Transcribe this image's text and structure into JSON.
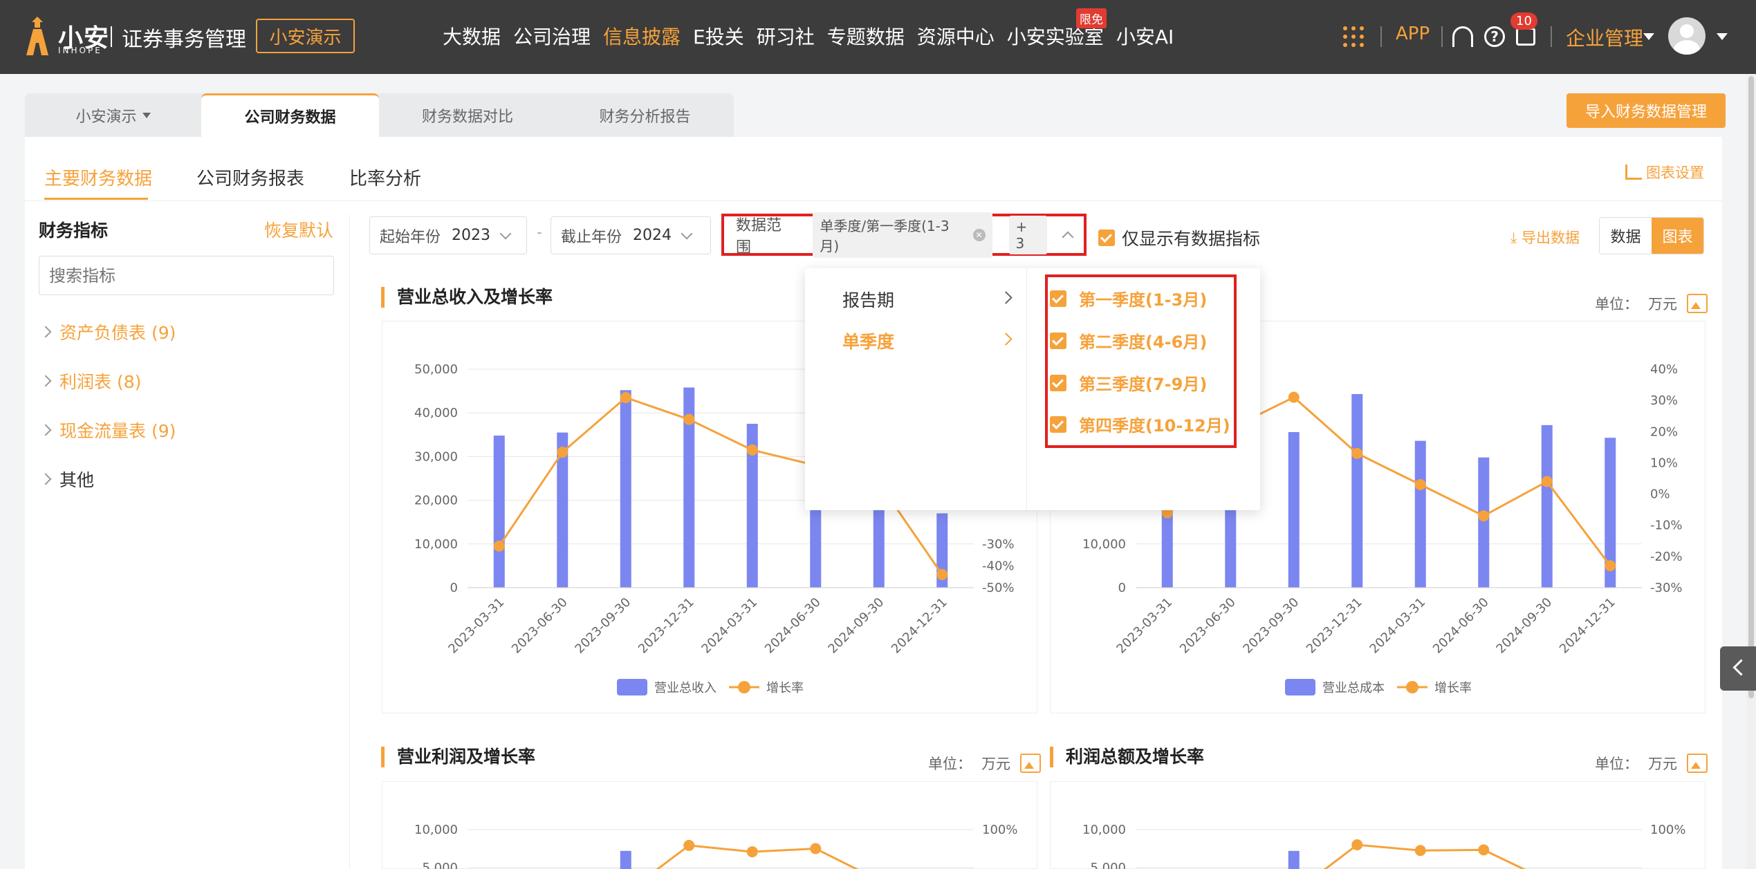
{
  "header": {
    "logo_text": "小安",
    "logo_sub": "INHOPE",
    "system_title": "证券事务管理",
    "demo_button": "小安演示",
    "nav": [
      {
        "label": "大数据",
        "active": false
      },
      {
        "label": "公司治理",
        "active": false
      },
      {
        "label": "信息披露",
        "active": true
      },
      {
        "label": "E投关",
        "active": false
      },
      {
        "label": "研习社",
        "active": false
      },
      {
        "label": "专题数据",
        "active": false
      },
      {
        "label": "资源中心",
        "active": false
      },
      {
        "label": "小安实验室",
        "active": false
      },
      {
        "label": "小安AI",
        "active": false
      }
    ],
    "free_badge": "限免",
    "app_link": "APP",
    "message_count": "10",
    "enterprise": "企业管理",
    "icons": [
      "apps-grid-icon",
      "headset-icon",
      "help-icon",
      "message-icon",
      "avatar"
    ]
  },
  "tabs": [
    {
      "label": "小安演示",
      "dropdown": true
    },
    {
      "label": "公司财务数据",
      "active": true
    },
    {
      "label": "财务数据对比"
    },
    {
      "label": "财务分析报告"
    }
  ],
  "import_button": "导入财务数据管理",
  "subtabs": [
    "主要财务数据",
    "公司财务报表",
    "比率分析"
  ],
  "chart_settings": "图表设置",
  "sidebar": {
    "title": "财务指标",
    "restore": "恢复默认",
    "search_placeholder": "搜索指标",
    "items": [
      {
        "label": "资产负债表 (9)"
      },
      {
        "label": "利润表 (8)"
      },
      {
        "label": "现金流量表 (9)"
      },
      {
        "label": "其他"
      }
    ]
  },
  "filters": {
    "start_label": "起始年份",
    "start_value": "2023",
    "dash": "-",
    "end_label": "截止年份",
    "end_value": "2024",
    "range_label": "数据范围",
    "range_tag": "单季度/第一季度(1-3月)",
    "range_more": "+ 3",
    "only_show": "仅显示有数据指标",
    "export": "导出数据",
    "view_data": "数据",
    "view_chart": "图表"
  },
  "dropdown": {
    "left": [
      {
        "label": "报告期",
        "active": false
      },
      {
        "label": "单季度",
        "active": true
      }
    ],
    "right": [
      {
        "label": "第一季度(1-3月)",
        "checked": true
      },
      {
        "label": "第二季度(4-6月)",
        "checked": true
      },
      {
        "label": "第三季度(7-9月)",
        "checked": true
      },
      {
        "label": "第四季度(10-12月)",
        "checked": true
      }
    ]
  },
  "unit_label": "单位：",
  "unit_value": "万元",
  "chart_data": [
    {
      "type": "bar",
      "title": "营业总收入及增长率",
      "categories": [
        "2023-03-31",
        "2023-06-30",
        "2023-09-30",
        "2023-12-31",
        "2024-03-31",
        "2024-06-30",
        "2024-09-30",
        "2024-12-31"
      ],
      "series": [
        {
          "name": "营业总收入",
          "type": "bar",
          "values": [
            34800,
            35500,
            45200,
            45800,
            37500,
            35000,
            31000,
            17000
          ],
          "color": "#7b86f0"
        },
        {
          "name": "增长率",
          "type": "line",
          "values": [
            -0.31,
            0.12,
            0.37,
            0.27,
            0.13,
            0.06,
            -0.02,
            -0.44
          ],
          "color": "#f6a23b"
        }
      ],
      "yticks_left": [
        "0",
        "10,000",
        "20,000",
        "30,000",
        "40,000",
        "50,000"
      ],
      "yticks_right": [
        "-50%",
        "-40%",
        "-30%"
      ],
      "ylim_left": [
        0,
        50000
      ],
      "ylim_right": [
        -0.5,
        0.5
      ]
    },
    {
      "type": "bar",
      "title": "",
      "categories": [
        "2023-03-31",
        "2023-06-30",
        "2023-09-30",
        "2023-12-31",
        "2024-03-31",
        "2024-06-30",
        "2024-09-30",
        "2024-12-31"
      ],
      "series": [
        {
          "name": "营业总成本",
          "type": "bar",
          "values": [
            20000,
            22000,
            35600,
            44300,
            33600,
            29800,
            37200,
            34300
          ],
          "color": "#7b86f0"
        },
        {
          "name": "增长率",
          "type": "line",
          "values": [
            -0.06,
            0.21,
            0.31,
            0.13,
            0.03,
            -0.07,
            0.04,
            -0.23
          ],
          "color": "#f6a23b"
        }
      ],
      "yticks_left": [
        "0",
        "10,000"
      ],
      "yticks_right": [
        "-30%",
        "-20%",
        "-10%",
        "0%",
        "10%",
        "20%",
        "30%",
        "40%"
      ],
      "ylim_left": [
        0,
        50000
      ],
      "ylim_right": [
        -0.3,
        0.4
      ]
    },
    {
      "type": "bar",
      "title": "营业利润及增长率",
      "categories": [
        "2023-03-31",
        "2023-06-30",
        "2023-09-30",
        "2023-12-31",
        "2024-03-31",
        "2024-06-30",
        "2024-09-30",
        "2024-12-31"
      ],
      "series": [
        {
          "name": "营业利润",
          "type": "bar",
          "values": [
            0,
            0,
            7200,
            0,
            0,
            0,
            0,
            0
          ],
          "color": "#7b86f0"
        },
        {
          "name": "增长率",
          "type": "line",
          "values": [
            null,
            null,
            0.0,
            0.75,
            0.65,
            0.7,
            0.2,
            null
          ],
          "color": "#f6a23b"
        }
      ],
      "yticks_left": [
        "5,000",
        "10,000"
      ],
      "yticks_right": [
        "100%"
      ]
    },
    {
      "type": "bar",
      "title": "利润总额及增长率",
      "categories": [
        "2023-03-31",
        "2023-06-30",
        "2023-09-30",
        "2023-12-31",
        "2024-03-31",
        "2024-06-30",
        "2024-09-30",
        "2024-12-31"
      ],
      "series": [
        {
          "name": "利润总额",
          "type": "bar",
          "values": [
            0,
            0,
            7200,
            0,
            0,
            0,
            0,
            0
          ],
          "color": "#7b86f0"
        },
        {
          "name": "增长率",
          "type": "line",
          "values": [
            null,
            null,
            0.0,
            0.76,
            0.67,
            0.68,
            0.2,
            null
          ],
          "color": "#f6a23b"
        }
      ],
      "yticks_left": [
        "5,000",
        "10,000"
      ],
      "yticks_right": [
        "100%"
      ]
    }
  ]
}
